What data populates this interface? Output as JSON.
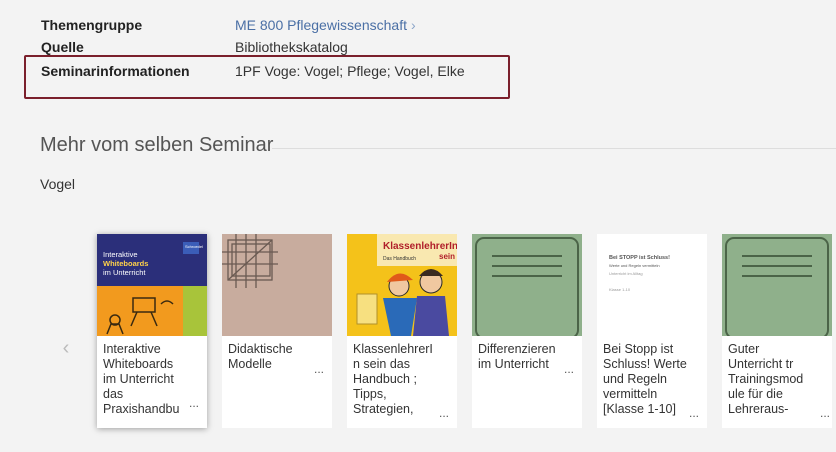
{
  "meta": {
    "themengruppe_label": "Themengruppe",
    "themengruppe_value": "ME 800 Pflegewissenschaft",
    "quelle_label": "Quelle",
    "quelle_value": "Bibliothekskatalog",
    "seminar_label": "Seminarinformationen",
    "seminar_value": "1PF Voge: Vogel; Pflege; Vogel, Elke"
  },
  "section": {
    "title": "Mehr vom selben Seminar",
    "seminar_name": "Vogel"
  },
  "carousel": {
    "prev_icon": "chevron-left-icon",
    "more_label": "...",
    "items": [
      {
        "title": "Interaktive\nWhiteboards\nim Unterricht\ndas\nPraxishandbu",
        "cover_publisher": "Schroedel",
        "cover_line1": "Interaktive",
        "cover_line2": "Whiteboards",
        "cover_line3": "im Unterricht"
      },
      {
        "title": "Didaktische\nModelle"
      },
      {
        "title": "KlassenlehrerI\nn sein das\nHandbuch ;\nTipps,\nStrategien,",
        "cover_line1": "Klassenlehrer",
        "cover_line2": "In",
        "cover_line3": "sein",
        "cover_line4": "Das Handbuch"
      },
      {
        "title": "Differenzieren\nim Unterricht"
      },
      {
        "title": "Bei Stopp ist\nSchluss! Werte\nund Regeln\nvermitteln\n[Klasse 1-10]",
        "cover_line1": "Bei STOPP ist Schluss!",
        "cover_line2": "Werte und Regeln vermitteln",
        "cover_line3": "Unterricht im Alltag",
        "cover_line4": "Klasse 1-10"
      },
      {
        "title": "Guter\nUnterricht tr\nTrainingsmod\nule für die\nLehreraus-"
      }
    ]
  },
  "colors": {
    "highlight_border": "#7a1f2b",
    "link": "#4a6fa5",
    "generic_cover": "#8fb08b"
  }
}
